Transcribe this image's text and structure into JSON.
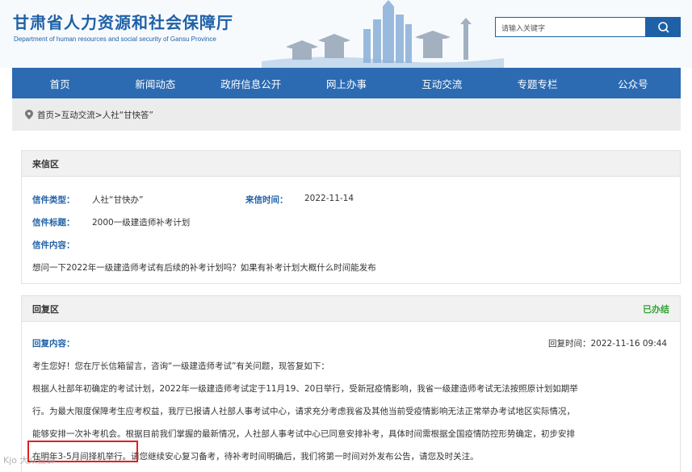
{
  "header": {
    "title": "甘肃省人力资源和社会保障厅",
    "subtitle": "Department of human resources and social security of Gansu Province",
    "search_placeholder": "请输入关键字"
  },
  "nav": {
    "items": [
      "首页",
      "新闻动态",
      "政府信息公开",
      "网上办事",
      "互动交流",
      "专题专栏",
      "公众号"
    ]
  },
  "breadcrumb": {
    "text": "首页>互动交流>人社“甘快答”"
  },
  "letter": {
    "section_title": "来信区",
    "type_label": "信件类型：",
    "type_value": "人社“甘快办”",
    "date_label": "来信时间：",
    "date_value": "2022-11-14",
    "subject_label": "信件标题：",
    "subject_value": "2000一级建造师补考计划",
    "content_label": "信件内容：",
    "content_value": "想问一下2022年一级建造师考试有后续的补考计划吗？如果有补考计划大概什么时间能发布"
  },
  "reply": {
    "section_title": "回复区",
    "status": "已办结",
    "content_label": "回复内容：",
    "time": "回复时间：2022-11-16 09:44",
    "paragraphs": [
      "考生您好！您在厅长信箱留言，咨询“一级建造师考试”有关问题，现答复如下：",
      "根据人社部年初确定的考试计划，2022年一级建造师考试定于11月19、20日举行，受新冠疫情影响，我省一级建造师考试无法按照原计划如期举",
      "行。为最大限度保障考生应考权益，我厅已报请人社部人事考试中心，请求充分考虑我省及其他当前受疫情影响无法正常举办考试地区实际情况，",
      "能够安排一次补考机会。根据目前我们掌握的最新情况，人社部人事考试中心已同意安排补考，具体时间需根据全国疫情防控形势确定，初步安排",
      "在明年3-5月间择机举行。请您继续安心复习备考，待补考时间明确后，我们将第一时间对外发布公告，请您及时关注。"
    ]
  },
  "watermark": "Kjo 大众投诉",
  "colors": {
    "brand_blue": "#1f61a7",
    "nav_blue": "#2c6bb1",
    "status_green": "#35a235",
    "highlight_red": "#e02020"
  }
}
